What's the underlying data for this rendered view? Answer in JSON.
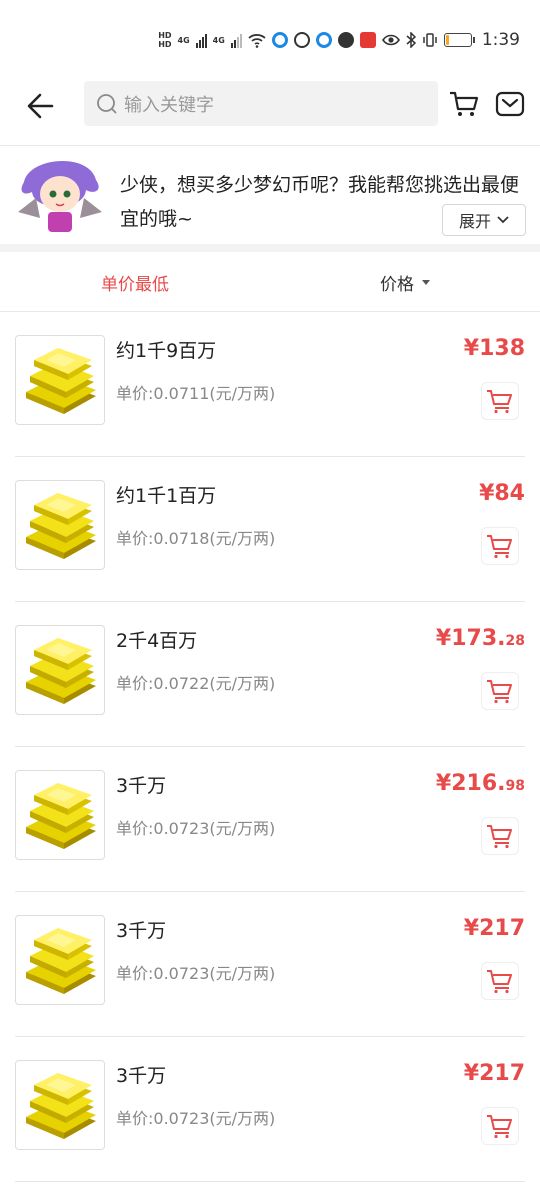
{
  "status_bar": {
    "hd1": "HD",
    "hd2": "HD",
    "net1": "4G",
    "net2": "4G",
    "time": "1:39",
    "battery_level": 0.15
  },
  "header": {
    "search_placeholder": "输入关键字"
  },
  "promo": {
    "message": "少侠，想买多少梦幻币呢？我能帮您挑选出最便宜的哦~",
    "expand_label": "展开"
  },
  "sort": {
    "left_label": "单价最低",
    "right_label": "价格"
  },
  "items": [
    {
      "title": "约1千9百万",
      "unit_price": "单价:0.0711(元/万两)",
      "price_int": "¥138",
      "price_dec": ""
    },
    {
      "title": "约1千1百万",
      "unit_price": "单价:0.0718(元/万两)",
      "price_int": "¥84",
      "price_dec": ""
    },
    {
      "title": "2千4百万",
      "unit_price": "单价:0.0722(元/万两)",
      "price_int": "¥173.",
      "price_dec": "28"
    },
    {
      "title": "3千万",
      "unit_price": "单价:0.0723(元/万两)",
      "price_int": "¥216.",
      "price_dec": "98"
    },
    {
      "title": "3千万",
      "unit_price": "单价:0.0723(元/万两)",
      "price_int": "¥217",
      "price_dec": ""
    },
    {
      "title": "3千万",
      "unit_price": "单价:0.0723(元/万两)",
      "price_int": "¥217",
      "price_dec": ""
    }
  ],
  "colors": {
    "accent": "#e84a4a",
    "muted": "#888888"
  },
  "icons": [
    "back-arrow-icon",
    "search-icon",
    "cart-icon",
    "mail-icon",
    "chevron-down-icon",
    "sort-triangle-icon",
    "gold-bars-icon",
    "add-to-cart-icon"
  ]
}
